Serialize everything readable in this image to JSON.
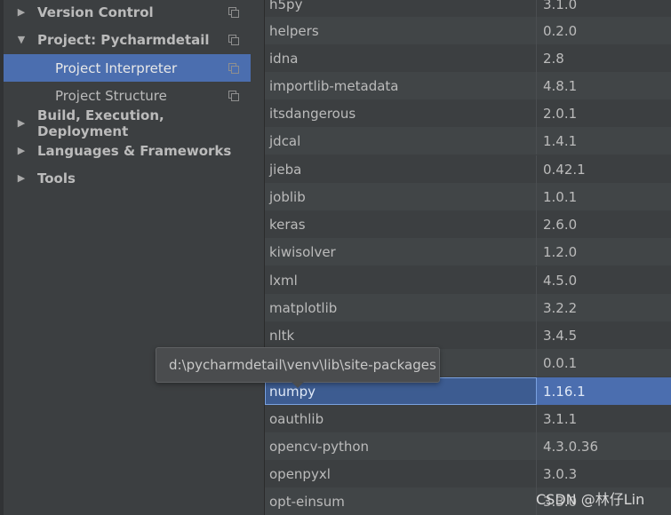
{
  "sidebar": {
    "items": [
      {
        "label": "Version Control",
        "expandable": true,
        "expanded": false,
        "bold": true
      },
      {
        "label": "Project: Pycharmdetail",
        "expandable": true,
        "expanded": true,
        "bold": true
      },
      {
        "label": "Project Interpreter",
        "expandable": false,
        "selected": true
      },
      {
        "label": "Project Structure",
        "expandable": false
      },
      {
        "label": "Build, Execution, Deployment",
        "expandable": true,
        "expanded": false,
        "bold": true
      },
      {
        "label": "Languages & Frameworks",
        "expandable": true,
        "expanded": false,
        "bold": true
      },
      {
        "label": "Tools",
        "expandable": true,
        "expanded": false,
        "bold": true
      }
    ]
  },
  "packages": [
    {
      "name": "h5py",
      "version": "3.1.0"
    },
    {
      "name": "helpers",
      "version": "0.2.0"
    },
    {
      "name": "idna",
      "version": "2.8"
    },
    {
      "name": "importlib-metadata",
      "version": "4.8.1"
    },
    {
      "name": "itsdangerous",
      "version": "2.0.1"
    },
    {
      "name": "jdcal",
      "version": "1.4.1"
    },
    {
      "name": "jieba",
      "version": "0.42.1"
    },
    {
      "name": "joblib",
      "version": "1.0.1"
    },
    {
      "name": "keras",
      "version": "2.6.0"
    },
    {
      "name": "kiwisolver",
      "version": "1.2.0"
    },
    {
      "name": "lxml",
      "version": "4.5.0"
    },
    {
      "name": "matplotlib",
      "version": "3.2.2"
    },
    {
      "name": "nltk",
      "version": "3.4.5"
    },
    {
      "name": "",
      "version": "0.0.1"
    },
    {
      "name": "numpy",
      "version": "1.16.1",
      "selected": true
    },
    {
      "name": "oauthlib",
      "version": "3.1.1"
    },
    {
      "name": "opencv-python",
      "version": "4.3.0.36"
    },
    {
      "name": "openpyxl",
      "version": "3.0.3"
    },
    {
      "name": "opt-einsum",
      "version": "3.3.0"
    }
  ],
  "tooltip": {
    "text": "d:\\pycharmdetail\\venv\\lib\\site-packages"
  },
  "watermark": {
    "text": "CSDN @林仔Lin"
  },
  "icons": {
    "expand_collapsed": "triangle-right-icon",
    "expand_open": "triangle-down-icon",
    "copy": "copy-settings-icon"
  }
}
